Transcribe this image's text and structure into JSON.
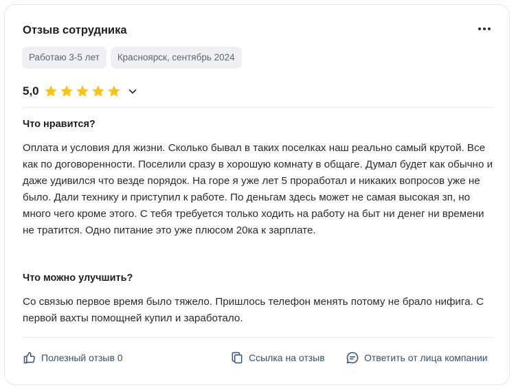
{
  "review": {
    "title": "Отзыв сотрудника",
    "tags": [
      "Работаю 3-5 лет",
      "Красноярск, сентябрь 2024"
    ],
    "rating": {
      "value": "5,0",
      "stars": 5,
      "max": 5,
      "star_color": "#f5c518"
    },
    "likes": {
      "label": "Что нравится?",
      "text": "Оплата и условия для жизни. Сколько бывал в таких поселках наш реально самый крутой. Все как по договоренности. Поселили сразу в хорошую комнату в общаге. Думал будет как обычно и даже удивился что везде порядок. На горе я уже лет 5 проработал и никаких вопросов уже не было. Дали технику и приступил к работе. По деньгам здесь может не самая высокая зп, но много чего кроме этого. С тебя требуется только ходить на работу на быт ни денег ни времени не тратится. Одно питание это уже плюсом 20ка к зарплате."
    },
    "improve": {
      "label": "Что можно улучшить?",
      "text": "Со связью первое время было тяжело. Пришлось телефон менять потому не брало нифига. С первой вахты помощней купил и заработало."
    },
    "actions": {
      "helpful": "Полезный отзыв 0",
      "link": "Ссылка на отзыв",
      "reply": "Ответить от лица компании"
    }
  },
  "icons": {
    "menu": "more-dots-icon",
    "expand": "chevron-down-icon",
    "helpful": "thumbs-up-icon",
    "link": "copy-link-icon",
    "reply": "chat-bubble-icon"
  },
  "colors": {
    "accent": "#2f4f7a",
    "chip_bg": "#eef0f3",
    "chip_text": "#5d6670"
  }
}
